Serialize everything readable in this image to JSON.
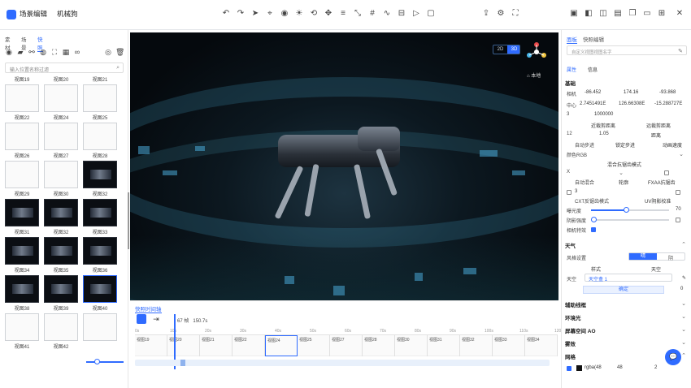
{
  "app": {
    "title": "场景编辑",
    "project": "机械狗"
  },
  "toolbar": {
    "icons": [
      "undo-icon",
      "redo-icon",
      "select-icon",
      "snap-icon",
      "camera-icon",
      "light-icon",
      "rotate-icon",
      "move-icon",
      "align-icon",
      "scale-icon",
      "grid-icon",
      "wave-icon",
      "measure-icon",
      "play-icon",
      "stop-icon"
    ],
    "right_icons": [
      "share-icon",
      "settings-icon",
      "fullscreen-icon"
    ],
    "window_icons": [
      "layout-icon",
      "layer-icon",
      "panel-icon",
      "dock-icon",
      "window-icon",
      "close-icon"
    ]
  },
  "left": {
    "tabs": [
      "素材",
      "场景",
      "快照"
    ],
    "active_tab": 2,
    "search_placeholder": "输入位置名称过滤",
    "tiles": [
      {
        "label": "视图19",
        "dark": false
      },
      {
        "label": "视图20",
        "dark": false
      },
      {
        "label": "视图21",
        "dark": false
      },
      {
        "label": "视图22",
        "dark": false
      },
      {
        "label": "视图24",
        "dark": false
      },
      {
        "label": "视图25",
        "dark": false
      },
      {
        "label": "视图26",
        "dark": false
      },
      {
        "label": "视图27",
        "dark": false
      },
      {
        "label": "视图28",
        "dark": false
      },
      {
        "label": "视图29",
        "dark": false
      },
      {
        "label": "视图30",
        "dark": false
      },
      {
        "label": "视图32",
        "dark": true
      },
      {
        "label": "视图31",
        "dark": true
      },
      {
        "label": "视图32",
        "dark": true
      },
      {
        "label": "视图33",
        "dark": true
      },
      {
        "label": "视图34",
        "dark": true
      },
      {
        "label": "视图35",
        "dark": true
      },
      {
        "label": "视图36",
        "dark": true
      },
      {
        "label": "视图38",
        "dark": true
      },
      {
        "label": "视图39",
        "dark": true
      },
      {
        "label": "视图40",
        "dark": true
      },
      {
        "label": "视图41",
        "dark": false
      },
      {
        "label": "视图42",
        "dark": false
      },
      {
        "label": "",
        "dark": false
      }
    ],
    "selected_tile": 20
  },
  "viewport": {
    "mode_2d": "2D",
    "mode_3d": "3D",
    "home_label": "本地"
  },
  "timeline": {
    "tab": "快照时间轴",
    "info_frames": "67 帧",
    "info_time": "150.7s",
    "ruler": [
      "0s",
      "10s",
      "20s",
      "30s",
      "40s",
      "50s",
      "60s",
      "70s",
      "80s",
      "90s",
      "100s",
      "110s",
      "120s"
    ],
    "keyframes": [
      "视图19",
      "视图20",
      "视图21",
      "视图22",
      "视图24",
      "视图25",
      "视图27",
      "视图28",
      "视图30",
      "视图31",
      "视图32",
      "视图33",
      "视图34"
    ]
  },
  "right": {
    "tabs": [
      "面板",
      "快照编辑"
    ],
    "name_placeholder": "自定义视图视图名字",
    "subtabs": [
      "属性",
      "信息"
    ],
    "section_basic": "基础",
    "pos_label": "相机",
    "pos": [
      "-86.452",
      "174.16",
      "-93.868"
    ],
    "center_label": "中心",
    "center": [
      "2.7451491E",
      "126.66308E",
      "-15.288727E"
    ],
    "near_label": "3",
    "far_value": "1000000",
    "near_far": {
      "left": "近裁剪距离",
      "right": "远裁剪距离"
    },
    "fov_row": {
      "a": "12",
      "b": "1.05",
      "c": "距离"
    },
    "auto_row": [
      "自动步进",
      "锁定步进",
      "动画速度"
    ],
    "color_mode": "颜色RGB",
    "blend_label": "混合抗锯齿模式",
    "blend_items": [
      "X",
      "自动混合",
      "轮廓",
      "FXAA抗锯齿"
    ],
    "effects": [
      "CXT反锯齿模式",
      "UV阴影校准"
    ],
    "exposure_label": "曝光度",
    "exposure_value": "70",
    "shadow_label": "阴影强度",
    "camera_fx_label": "相机特效",
    "section_atmos": "天气",
    "weather_label": "风格设置",
    "weather_options": [
      "晴",
      "阴"
    ],
    "style_label": "样式",
    "style_value": "天空",
    "sky_label": "天空",
    "sky_value": "天空盒 1",
    "confirm": "确定",
    "zero": "0",
    "sections": [
      "辅助线框",
      "环境光",
      "屏幕空间 AO",
      "雾效",
      "网格"
    ],
    "grid_row": {
      "color": "rgba(48",
      "size": "48",
      "count": "2"
    }
  },
  "chat": {
    "label": "客服"
  }
}
